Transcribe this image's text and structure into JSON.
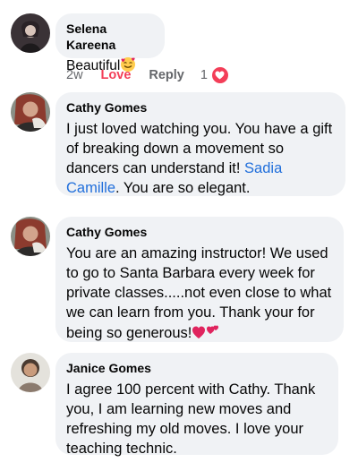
{
  "comments": [
    {
      "author": "Selena Kareena",
      "text": "Beautiful",
      "emoji": "smiling-face-with-hearts",
      "time": "2w",
      "love_label": "Love",
      "reply_label": "Reply",
      "reaction_count": "1"
    },
    {
      "author": "Cathy Gomes",
      "text_before": "I just loved watching you. You have a gift of breaking down a movement so dancers can understand it! ",
      "mention": "Sadia Camille",
      "text_after": ". You are so elegant."
    },
    {
      "author": "Cathy Gomes",
      "text": "You are an amazing instructor! We used to go to Santa Barbara every week for private classes.....not even close to what we can learn from you. Thank your for being so generous!",
      "emoji": "two-hearts"
    },
    {
      "author": "Janice Gomes",
      "text": "I agree 100 percent with Cathy. Thank you, I am learning new moves and refreshing my old moves. I love your teaching technic."
    }
  ],
  "colors": {
    "bubble": "#f0f2f5",
    "love": "#f33e58",
    "link": "#216fdb",
    "meta": "#65676b"
  }
}
